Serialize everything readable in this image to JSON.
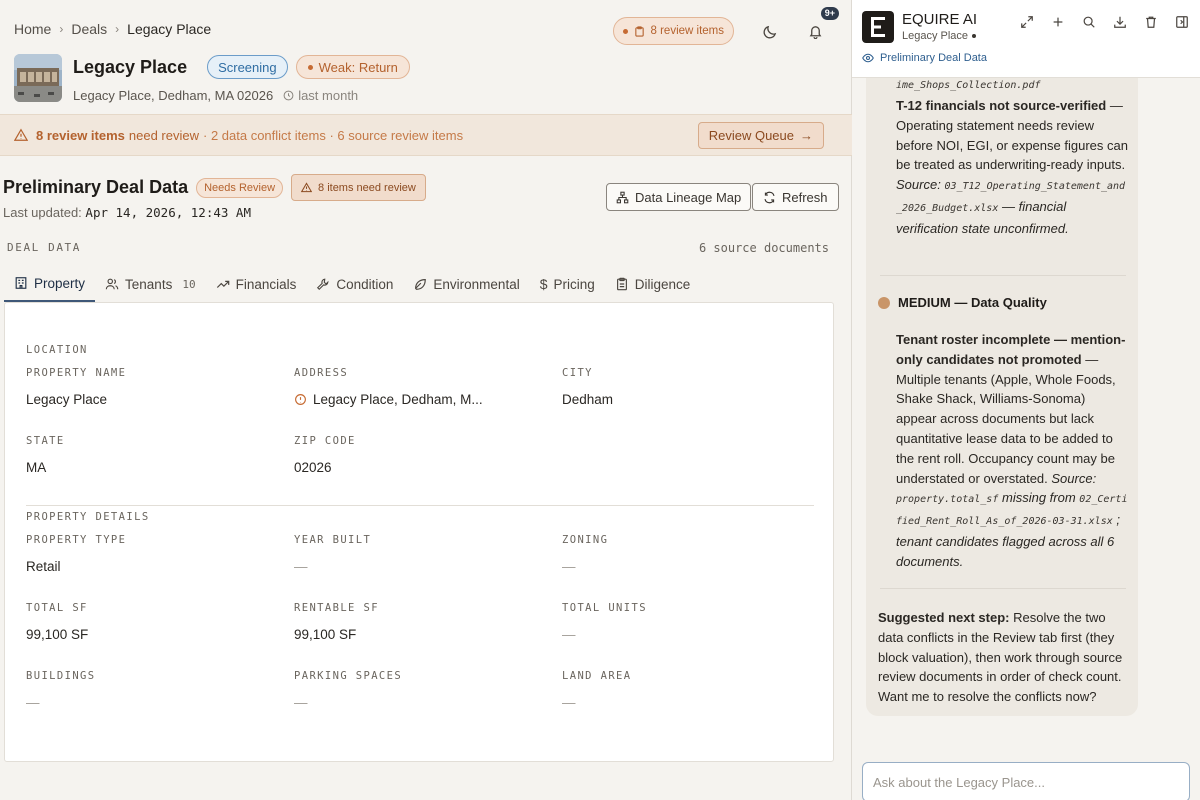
{
  "breadcrumb": {
    "items": [
      "Home",
      "Deals"
    ],
    "current": "Legacy Place"
  },
  "header": {
    "review_pill": "8 review items",
    "notif_badge": "9+"
  },
  "property": {
    "title": "Legacy Place",
    "status_chip": "Screening",
    "rating_chip": "Weak: Return",
    "address_line": "Legacy Place, Dedham, MA 02026",
    "updated_rel": "last month"
  },
  "alert": {
    "strong": "8 review items",
    "after_strong": "need review",
    "rest": "· 2 data conflict items · 6 source review items",
    "button": "Review Queue"
  },
  "section": {
    "title": "Preliminary Deal Data",
    "needs_review": "Needs Review",
    "items_review": "8 items need review",
    "last_updated_label": "Last updated:",
    "last_updated_value": "Apr 14, 2026, 12:43 AM",
    "lineage_button": "Data Lineage Map",
    "refresh_button": "Refresh",
    "deal_data_label": "DEAL DATA",
    "source_docs": "6 source documents"
  },
  "tabs": [
    {
      "label": "Property",
      "icon": "building-icon",
      "active": true
    },
    {
      "label": "Tenants",
      "icon": "users-icon",
      "count": "10"
    },
    {
      "label": "Financials",
      "icon": "trend-icon"
    },
    {
      "label": "Condition",
      "icon": "wrench-icon"
    },
    {
      "label": "Environmental",
      "icon": "leaf-icon"
    },
    {
      "label": "Pricing",
      "icon": "dollar-icon"
    },
    {
      "label": "Diligence",
      "icon": "clipboard-icon"
    }
  ],
  "location": {
    "group_label": "LOCATION",
    "property_name": {
      "label": "PROPERTY NAME",
      "value": "Legacy Place"
    },
    "address": {
      "label": "ADDRESS",
      "value": "Legacy Place, Dedham, M..."
    },
    "city": {
      "label": "CITY",
      "value": "Dedham"
    },
    "state": {
      "label": "STATE",
      "value": "MA"
    },
    "zip": {
      "label": "ZIP CODE",
      "value": "02026"
    }
  },
  "details": {
    "group_label": "PROPERTY DETAILS",
    "property_type": {
      "label": "PROPERTY TYPE",
      "value": "Retail"
    },
    "year_built": {
      "label": "YEAR BUILT",
      "value": "—"
    },
    "zoning": {
      "label": "ZONING",
      "value": "—"
    },
    "total_sf": {
      "label": "TOTAL SF",
      "value": "99,100 SF"
    },
    "rentable_sf": {
      "label": "RENTABLE SF",
      "value": "99,100 SF"
    },
    "total_units": {
      "label": "TOTAL UNITS",
      "value": "—"
    },
    "buildings": {
      "label": "BUILDINGS",
      "value": "—"
    },
    "parking": {
      "label": "PARKING SPACES",
      "value": "—"
    },
    "land_area": {
      "label": "LAND AREA",
      "value": "—"
    }
  },
  "chat": {
    "app_name": "EQUIRE AI",
    "app_sub": "Legacy Place",
    "context": "Preliminary Deal Data",
    "msg_top_file": "ime_Shops_Collection.pdf",
    "t12_title": "T-12 financials not source-verified",
    "t12_body": "— Operating statement needs review before NOI, EGI, or expense figures can be treated as underwriting-ready inputs.",
    "t12_source_label": "Source:",
    "t12_source_file": "03_T12_Operating_Statement_and_2026_Budget.xlsx",
    "t12_tail": "— financial verification state unconfirmed.",
    "medium_head": "MEDIUM — Data Quality",
    "tenant_title": "Tenant roster incomplete — mention-only candidates not promoted",
    "tenant_body": "— Multiple tenants (Apple, Whole Foods, Shake Shack, Williams-Sonoma) appear across documents but lack quantitative lease data to be added to the rent roll. Occupancy count may be understated or overstated.",
    "tenant_source_label": "Source:",
    "tenant_source_field": "property.total_sf",
    "tenant_missing": "missing from",
    "tenant_source_file": "02_Certified_Rent_Roll_As_of_2026-03-31.xlsx",
    "tenant_tail": "; tenant candidates flagged across all 6 documents.",
    "next_label": "Suggested next step:",
    "next_body": "Resolve the two data conflicts in the Review tab first (they block valuation), then work through source review documents in order of check count. Want me to resolve the conflicts now?",
    "input_placeholder": "Ask about the Legacy Place..."
  }
}
